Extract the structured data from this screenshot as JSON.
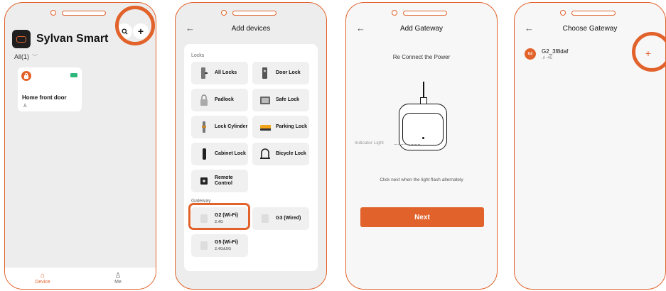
{
  "colors": {
    "accent": "#e2622b",
    "battery": "#2db77b"
  },
  "screen1": {
    "app_title": "Sylvan Smart",
    "filter": "All(1)",
    "search_icon": "search-icon",
    "add_icon": "plus-icon",
    "add_symbol": "+",
    "device": {
      "name": "Home front door",
      "user_glyph": "♙"
    },
    "tabs": [
      {
        "label": "Device"
      },
      {
        "label": "Me"
      }
    ]
  },
  "screen2": {
    "back": "←",
    "title": "Add devices",
    "locks_section": "Locks",
    "locks": [
      {
        "label": "All Locks"
      },
      {
        "label": "Door Lock"
      },
      {
        "label": "Padlock"
      },
      {
        "label": "Safe Lock"
      },
      {
        "label": "Lock Cylinder"
      },
      {
        "label": "Parking Lock"
      },
      {
        "label": "Cabinet Lock"
      },
      {
        "label": "Bicycle Lock"
      },
      {
        "label": "Remote Control"
      }
    ],
    "gateway_section": "Gateway",
    "gateways": [
      {
        "label": "G2 (Wi-Fi)",
        "sub": "2.4G"
      },
      {
        "label": "G3 (Wired)",
        "sub": ""
      },
      {
        "label": "G5 (Wi-Fi)",
        "sub": "2.4G&5G"
      }
    ]
  },
  "screen3": {
    "back": "←",
    "title": "Add Gateway",
    "heading": "Re Connect the Power",
    "indicator_label": "Indicator Light",
    "hint": "Click next when the light flash alternately",
    "next_label": "Next"
  },
  "screen4": {
    "back": "←",
    "title": "Choose Gateway",
    "gateway": {
      "badge": "G2",
      "name": "G2_3f8daf",
      "signal": ".ıl -45"
    },
    "add_symbol": "+"
  }
}
